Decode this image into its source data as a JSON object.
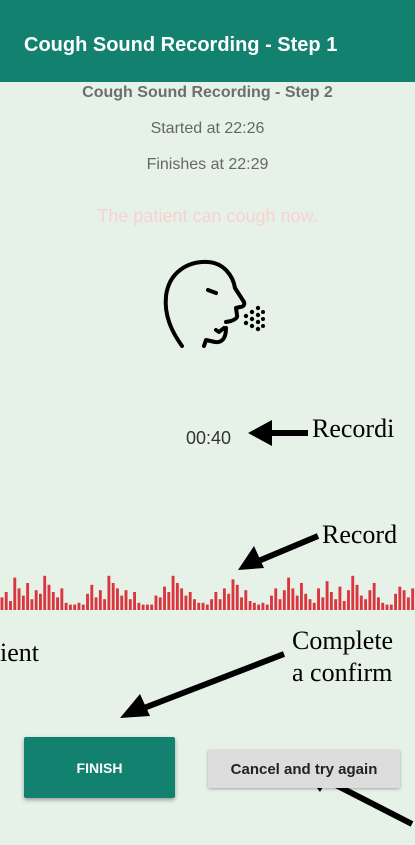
{
  "appbar": {
    "title": "Cough Sound Recording - Step 1"
  },
  "screen": {
    "step_title": "Cough Sound Recording - Step 2",
    "started": "Started at 22:26",
    "finishes": "Finishes at 22:29",
    "instruction": "The patient can cough now.",
    "timer": "00:40",
    "cough_icon": "person-coughing-icon"
  },
  "buttons": {
    "finish": "FINISH",
    "cancel": "Cancel and try again"
  },
  "annotations": {
    "timer_note": "Recordi",
    "wave_note": "Record",
    "left_note": "ient",
    "complete_line1": "Complete",
    "complete_line2": "a confirm"
  },
  "waveform": {
    "levels": [
      0.35,
      0.5,
      0.25,
      0.9,
      0.6,
      0.4,
      0.75,
      0.3,
      0.55,
      0.45,
      0.95,
      0.7,
      0.5,
      0.35,
      0.6,
      0.2,
      0.15,
      0.15,
      0.2,
      0.15,
      0.45,
      0.7,
      0.35,
      0.55,
      0.3,
      0.95,
      0.75,
      0.6,
      0.4,
      0.55,
      0.3,
      0.5,
      0.2,
      0.15,
      0.15,
      0.15,
      0.4,
      0.35,
      0.65,
      0.5,
      0.95,
      0.75,
      0.6,
      0.4,
      0.5,
      0.3,
      0.2,
      0.2,
      0.15,
      0.3,
      0.5,
      0.3,
      0.6,
      0.45,
      0.85,
      0.7,
      0.35,
      0.55,
      0.25,
      0.2,
      0.15,
      0.2,
      0.15,
      0.4,
      0.6,
      0.3,
      0.55,
      0.9,
      0.6,
      0.4,
      0.75,
      0.45,
      0.3,
      0.2,
      0.6,
      0.35,
      0.8,
      0.5,
      0.3,
      0.65,
      0.25,
      0.55,
      0.95,
      0.7,
      0.4,
      0.3,
      0.55,
      0.75,
      0.35,
      0.2,
      0.15,
      0.15,
      0.45,
      0.65,
      0.55,
      0.35,
      0.6
    ],
    "color": "#d9363e"
  },
  "colors": {
    "primary": "#138170",
    "background": "#e6f2e8",
    "instruction": "#f7d2cf",
    "cancel_bg": "#dcdcdc"
  }
}
